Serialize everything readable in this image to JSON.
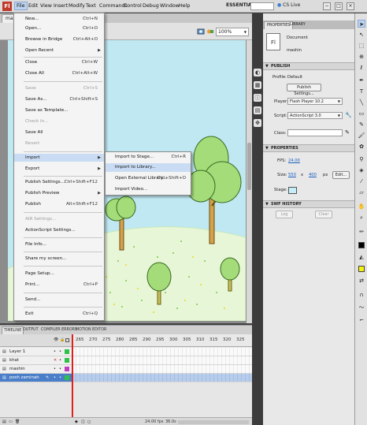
{
  "menubar": {
    "logo": "Fl",
    "items": [
      "File",
      "Edit",
      "View",
      "Insert",
      "Modify",
      "Text",
      "Commands",
      "Control",
      "Debug",
      "Window",
      "Help"
    ],
    "workspace": "ESSENTIALS",
    "cs_live": "CS Live",
    "window_buttons": [
      "−",
      "□",
      "×"
    ]
  },
  "document": {
    "tab_label": "mashin",
    "zoom": "100%"
  },
  "file_menu": {
    "items": [
      {
        "label": "New...",
        "shortcut": "Ctrl+N"
      },
      {
        "label": "Open...",
        "shortcut": "Ctrl+O"
      },
      {
        "label": "Browse in Bridge",
        "shortcut": "Ctrl+Alt+O"
      },
      {
        "label": "Open Recent",
        "shortcut": ""
      },
      {
        "label": "Close",
        "shortcut": "Ctrl+W"
      },
      {
        "label": "Close All",
        "shortcut": "Ctrl+Alt+W"
      },
      {
        "label": "Save",
        "shortcut": "Ctrl+S"
      },
      {
        "label": "Save As...",
        "shortcut": "Ctrl+Shift+S"
      },
      {
        "label": "Save as Template...",
        "shortcut": ""
      },
      {
        "label": "Check In...",
        "shortcut": ""
      },
      {
        "label": "Save All",
        "shortcut": ""
      },
      {
        "label": "Revert",
        "shortcut": ""
      },
      {
        "label": "Import",
        "shortcut": ""
      },
      {
        "label": "Export",
        "shortcut": ""
      },
      {
        "label": "Publish Settings...",
        "shortcut": "Ctrl+Shift+F12"
      },
      {
        "label": "Publish Preview",
        "shortcut": ""
      },
      {
        "label": "Publish",
        "shortcut": "Alt+Shift+F12"
      },
      {
        "label": "AIR Settings...",
        "shortcut": ""
      },
      {
        "label": "ActionScript Settings...",
        "shortcut": ""
      },
      {
        "label": "File Info...",
        "shortcut": ""
      },
      {
        "label": "Share my screen...",
        "shortcut": ""
      },
      {
        "label": "Page Setup...",
        "shortcut": ""
      },
      {
        "label": "Print...",
        "shortcut": "Ctrl+P"
      },
      {
        "label": "Send...",
        "shortcut": ""
      },
      {
        "label": "Exit",
        "shortcut": "Ctrl+Q"
      }
    ]
  },
  "import_menu": {
    "items": [
      {
        "label": "Import to Stage...",
        "shortcut": "Ctrl+R"
      },
      {
        "label": "Import to Library...",
        "shortcut": ""
      },
      {
        "label": "Open External Library...",
        "shortcut": "Ctrl+Shift+O"
      },
      {
        "label": "Import Video...",
        "shortcut": ""
      }
    ]
  },
  "timeline": {
    "tabs": [
      "TIMELINE",
      "OUTPUT",
      "COMPILER ERRORS",
      "MOTION EDITOR"
    ],
    "ruler": [
      "265",
      "270",
      "275",
      "280",
      "285",
      "290",
      "295",
      "300",
      "305",
      "310",
      "315",
      "320",
      "325"
    ],
    "layers": [
      {
        "name": "Layer 1",
        "color": "#2ec24a"
      },
      {
        "name": "khat",
        "color": "#2ec24a"
      },
      {
        "name": "mashin",
        "color": "#c03cc0"
      },
      {
        "name": "posh zaminah",
        "color": "#2ec24a"
      }
    ],
    "readout": [
      "24.00 fps",
      "36.0s"
    ]
  },
  "properties": {
    "tabs": [
      "PROPERTIES",
      "LIBRARY"
    ],
    "doc_icon": "Fl",
    "doc_type": "Document",
    "doc_name": "mashin",
    "publish_title": "PUBLISH",
    "profile_label": "Profile:",
    "profile_value": "Default",
    "publish_settings_btn": "Publish Settings...",
    "player_label": "Player:",
    "player_value": "Flash Player 10.2",
    "script_label": "Script:",
    "script_value": "ActionScript 3.0",
    "class_label": "Class:",
    "props_title": "PROPERTIES",
    "fps_label": "FPS:",
    "fps_value": "24.00",
    "size_label": "Size:",
    "width": "550",
    "x_sep": "x",
    "height": "400",
    "unit": "px",
    "edit_btn": "Edit...",
    "stage_label": "Stage:",
    "swf_title": "SWF HISTORY",
    "log_btn": "Log",
    "clear_btn": "Clear"
  },
  "colors": {
    "stage_bg": "#bfe8f3",
    "hill": "#e8f6d8",
    "leaf": "#a4dc7a",
    "trunk": "#d4a24a",
    "menu_highlight": "#c9dcf3"
  }
}
